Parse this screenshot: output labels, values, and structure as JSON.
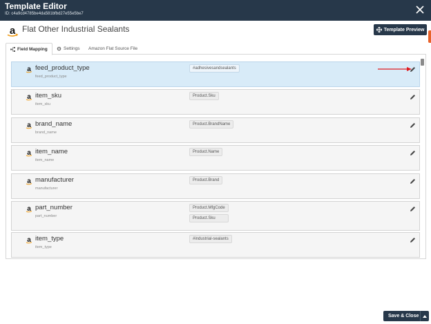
{
  "window": {
    "title": "Template Editor",
    "id_text": "ID: c4a9cd4785be4da581bfbd27e55e5be7"
  },
  "header": {
    "title": "Flat Other Industrial Sealants",
    "preview_label": "Template Preview"
  },
  "tabs": [
    {
      "label": "Field Mapping",
      "active": true
    },
    {
      "label": "Settings",
      "active": false
    },
    {
      "label": "Amazon Flat Source File",
      "active": false
    }
  ],
  "rows": [
    {
      "name": "feed_product_type",
      "sub": "feed_product_type",
      "mappings": [
        "#adhesivesandsealants"
      ],
      "active": true
    },
    {
      "name": "item_sku",
      "sub": "item_sku",
      "mappings": [
        "Product.Sku"
      ],
      "active": false
    },
    {
      "name": "brand_name",
      "sub": "brand_name",
      "mappings": [
        "Product.BrandName"
      ],
      "active": false
    },
    {
      "name": "item_name",
      "sub": "item_name",
      "mappings": [
        "Product.Name"
      ],
      "active": false
    },
    {
      "name": "manufacturer",
      "sub": "manufacturer",
      "mappings": [
        "Product.Brand"
      ],
      "active": false
    },
    {
      "name": "part_number",
      "sub": "part_number",
      "mappings": [
        "Product.MfgCode",
        "Product.Sku"
      ],
      "active": false
    },
    {
      "name": "item_type",
      "sub": "item_type",
      "mappings": [
        "#industrial-sealants"
      ],
      "active": false
    }
  ],
  "footer": {
    "save_label": "Save & Close"
  },
  "colors": {
    "navy": "#27384a",
    "highlight": "#d8ebf8",
    "arrow": "#e0191e",
    "accent": "#e8622a"
  }
}
